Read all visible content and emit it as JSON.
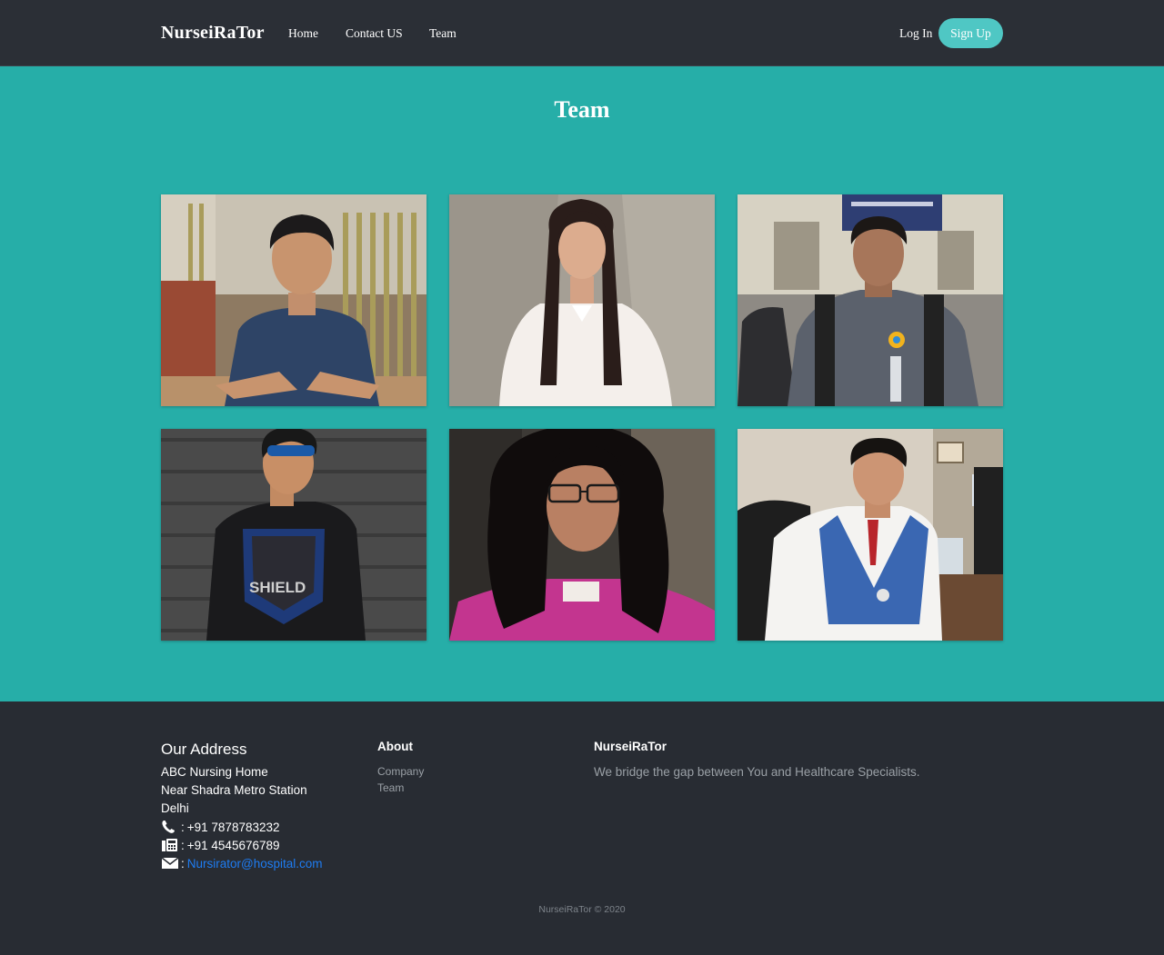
{
  "nav": {
    "brand": "NurseiRaTor",
    "links": [
      "Home",
      "Contact US",
      "Team"
    ],
    "login": "Log In",
    "signup": "Sign Up",
    "accent": "#4fc7c4"
  },
  "team": {
    "title": "Team",
    "background": "#26aea8",
    "members": [
      {
        "photo": "team-member-photo-1"
      },
      {
        "photo": "team-member-photo-2"
      },
      {
        "photo": "team-member-photo-3"
      },
      {
        "photo": "team-member-photo-4"
      },
      {
        "photo": "team-member-photo-5"
      },
      {
        "photo": "team-member-photo-6"
      }
    ]
  },
  "footer": {
    "address_heading": "Our Address",
    "address_lines": [
      "ABC Nursing Home",
      "Near Shadra Metro Station",
      "Delhi"
    ],
    "phone": "+91 7878783232",
    "fax": "+91 4545676789",
    "email": "Nursirator@hospital.com",
    "icons": [
      "phone-icon",
      "fax-icon",
      "envelope-icon"
    ],
    "about_heading": "About",
    "about_links": [
      "Company",
      "Team"
    ],
    "brand_heading": "NurseiRaTor",
    "tagline": "We bridge the gap between You and Healthcare Specialists.",
    "copyright": "NurseiRaTor © 2020"
  }
}
